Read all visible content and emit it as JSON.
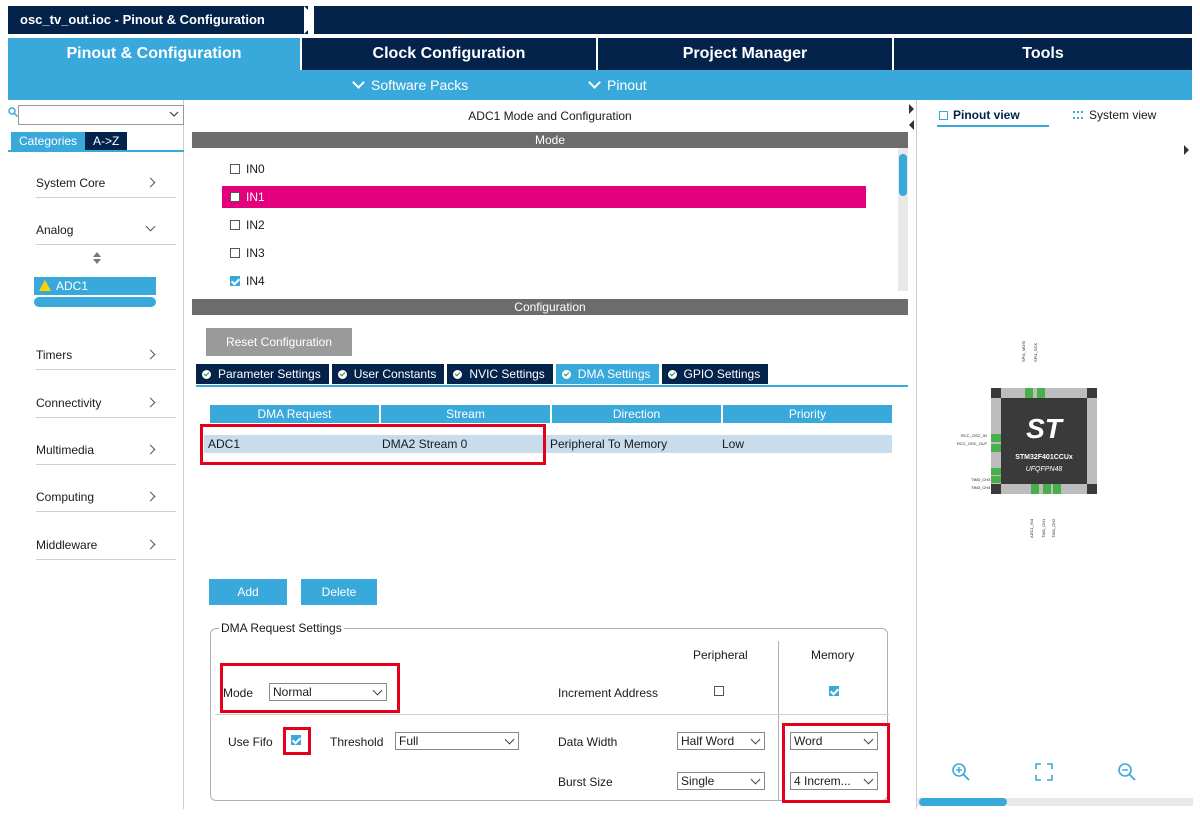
{
  "window": {
    "breadcrumb": "osc_tv_out.ioc - Pinout & Configuration"
  },
  "main_tabs": [
    {
      "label": "Pinout & Configuration",
      "active": true
    },
    {
      "label": "Clock Configuration",
      "active": false
    },
    {
      "label": "Project Manager",
      "active": false
    },
    {
      "label": "Tools",
      "active": false
    }
  ],
  "sub_menu": {
    "software_packs": "Software Packs",
    "pinout": "Pinout"
  },
  "sidebar": {
    "category_tabs": [
      "Categories",
      "A->Z"
    ],
    "items": [
      {
        "label": "System Core",
        "expanded": false
      },
      {
        "label": "Analog",
        "expanded": true
      },
      {
        "label": "Timers",
        "expanded": false
      },
      {
        "label": "Connectivity",
        "expanded": false
      },
      {
        "label": "Multimedia",
        "expanded": false
      },
      {
        "label": "Computing",
        "expanded": false
      },
      {
        "label": "Middleware",
        "expanded": false
      }
    ],
    "analog_children": [
      {
        "label": "ADC1",
        "warning": true,
        "selected": true
      }
    ]
  },
  "center": {
    "title": "ADC1 Mode and Configuration",
    "mode_header": "Mode",
    "mode_items": [
      {
        "label": "IN0",
        "checked": false,
        "selected": false
      },
      {
        "label": "IN1",
        "checked": false,
        "selected": true
      },
      {
        "label": "IN2",
        "checked": false,
        "selected": false
      },
      {
        "label": "IN3",
        "checked": false,
        "selected": false
      },
      {
        "label": "IN4",
        "checked": true,
        "selected": false
      }
    ],
    "configuration_header": "Configuration",
    "reset_button": "Reset Configuration",
    "config_tabs": [
      {
        "label": "Parameter Settings",
        "active": false
      },
      {
        "label": "User Constants",
        "active": false
      },
      {
        "label": "NVIC Settings",
        "active": false
      },
      {
        "label": "DMA Settings",
        "active": true
      },
      {
        "label": "GPIO Settings",
        "active": false
      }
    ]
  },
  "dma_table": {
    "columns": [
      "DMA Request",
      "Stream",
      "Direction",
      "Priority"
    ],
    "rows": [
      {
        "request": "ADC1",
        "stream": "DMA2 Stream 0",
        "direction": "Peripheral To Memory",
        "priority": "Low"
      }
    ]
  },
  "buttons": {
    "add": "Add",
    "delete": "Delete"
  },
  "dma_request_settings": {
    "legend": "DMA Request Settings",
    "peripheral_header": "Peripheral",
    "memory_header": "Memory",
    "mode_label": "Mode",
    "mode_value": "Normal",
    "increment_address_label": "Increment Address",
    "increment_peripheral": false,
    "increment_memory": true,
    "use_fifo_label": "Use Fifo",
    "use_fifo": true,
    "threshold_label": "Threshold",
    "threshold_value": "Full",
    "data_width_label": "Data Width",
    "data_width_peripheral": "Half Word",
    "data_width_memory": "Word",
    "burst_size_label": "Burst Size",
    "burst_size_peripheral": "Single",
    "burst_size_memory": "4 Increm..."
  },
  "right_panel": {
    "tabs": [
      "Pinout view",
      "System view"
    ],
    "chip_logo": "ST",
    "chip_name": "STM32F401CCUx",
    "chip_package": "UFQFPN48",
    "pin_labels": {
      "left": [
        "RCC_OSC_IN",
        "RCC_OSC_OUT",
        "TIM3_CH3",
        "TIM3_CH4"
      ],
      "top": [
        "SPI1_MOSI",
        "SPI1_SCK"
      ],
      "bottom": [
        "ADC1_IN4",
        "TIM1_CH1",
        "TIM1_CH2"
      ]
    }
  },
  "colors": {
    "navy": "#03234b",
    "accent": "#39a9dc",
    "selected_mode": "#e4007c",
    "highlight": "#e3001b",
    "warning": "#ffd200"
  }
}
